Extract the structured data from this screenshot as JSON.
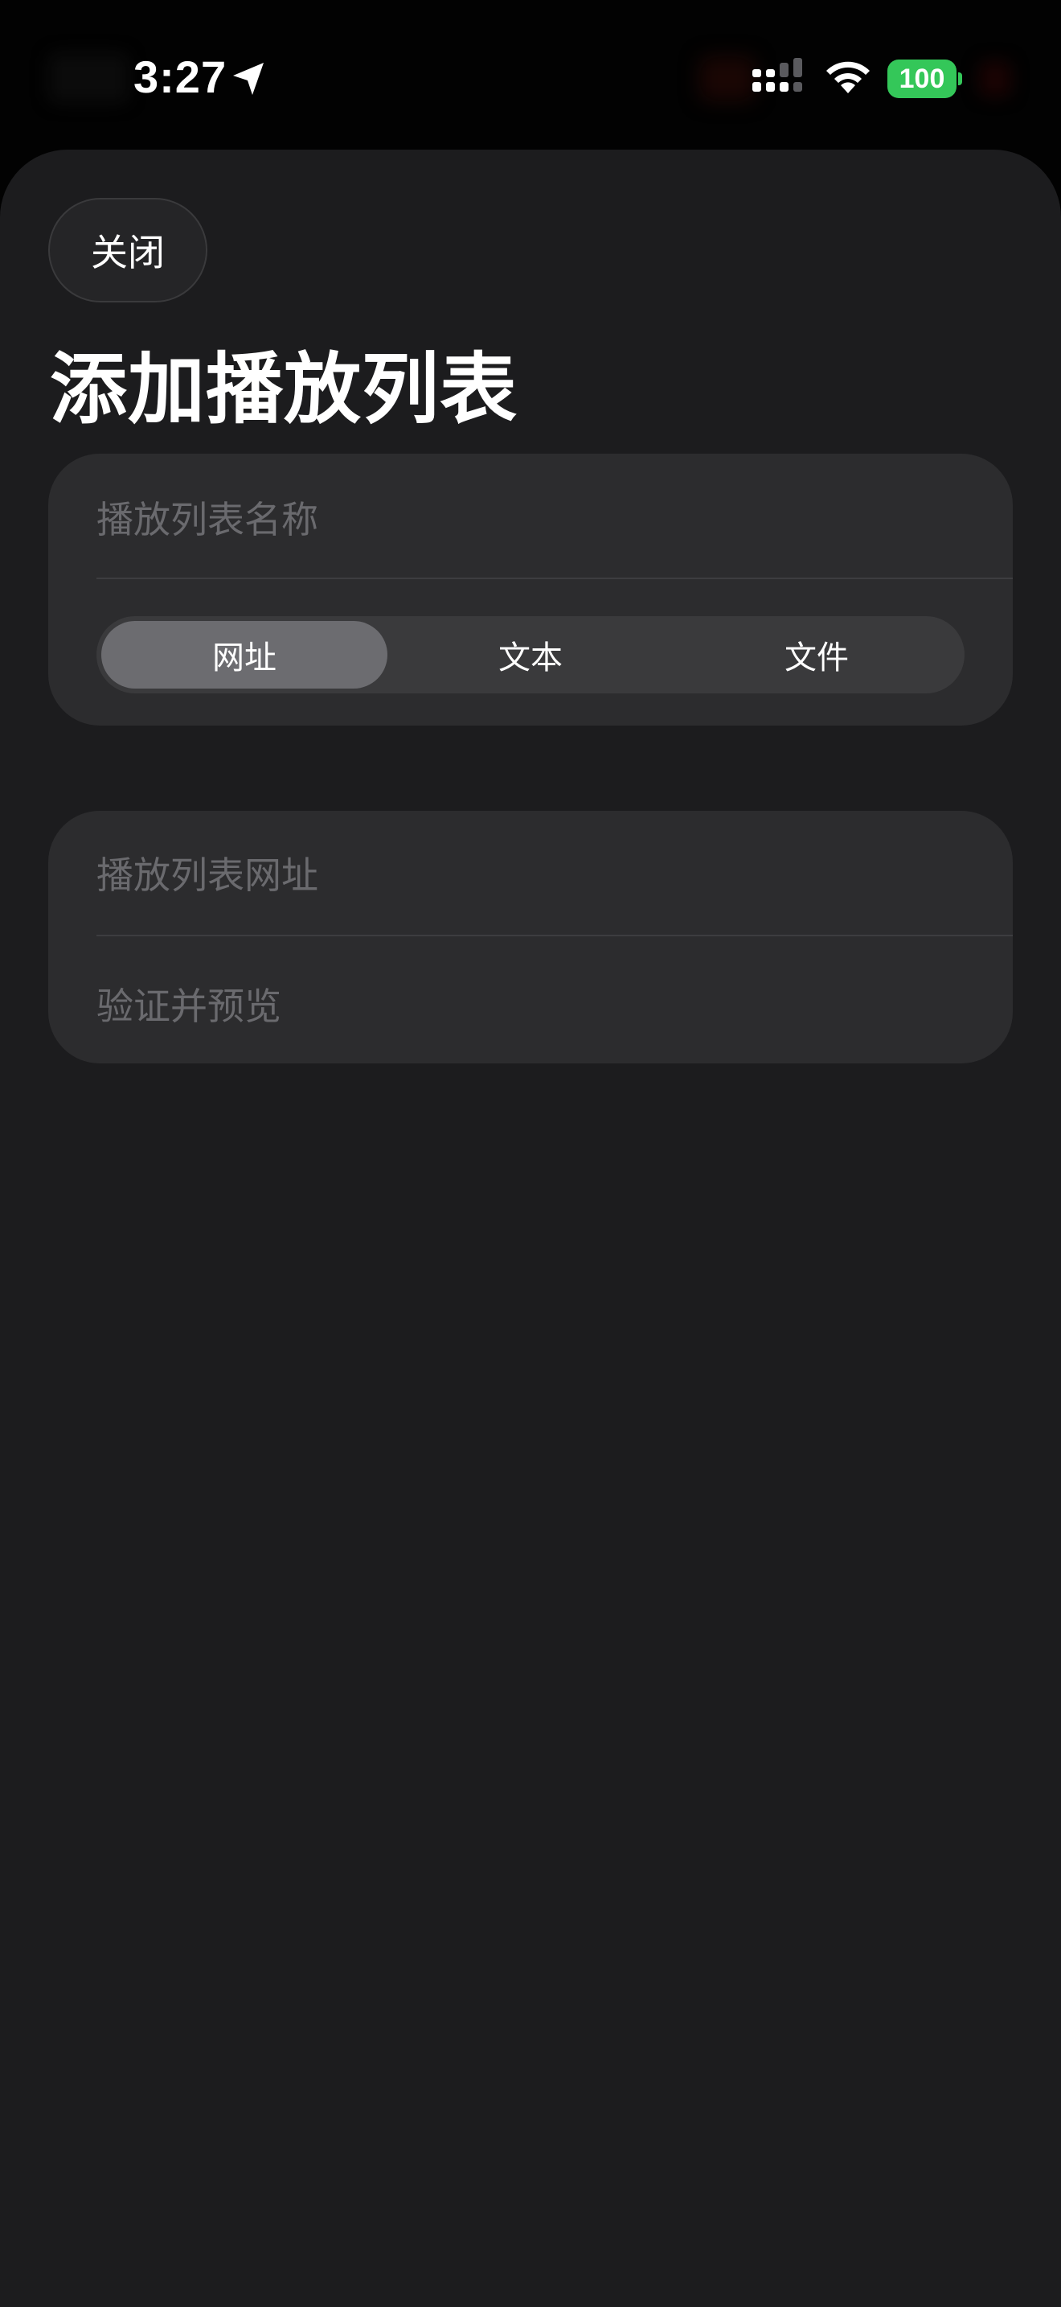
{
  "status_bar": {
    "time": "3:27",
    "battery_level": "100",
    "battery_color": "#34c759"
  },
  "sheet": {
    "close_label": "关闭",
    "title": "添加播放列表",
    "name_field": {
      "placeholder": "播放列表名称",
      "value": ""
    },
    "source_type": {
      "options": [
        "网址",
        "文本",
        "文件"
      ],
      "selected": "网址"
    },
    "url_field": {
      "placeholder": "播放列表网址",
      "value": ""
    },
    "verify_label": "验证并预览"
  },
  "icons": {
    "location": "location-arrow-icon",
    "cellular": "cellular-signal-icon",
    "wifi": "wifi-icon",
    "battery": "battery-icon"
  }
}
